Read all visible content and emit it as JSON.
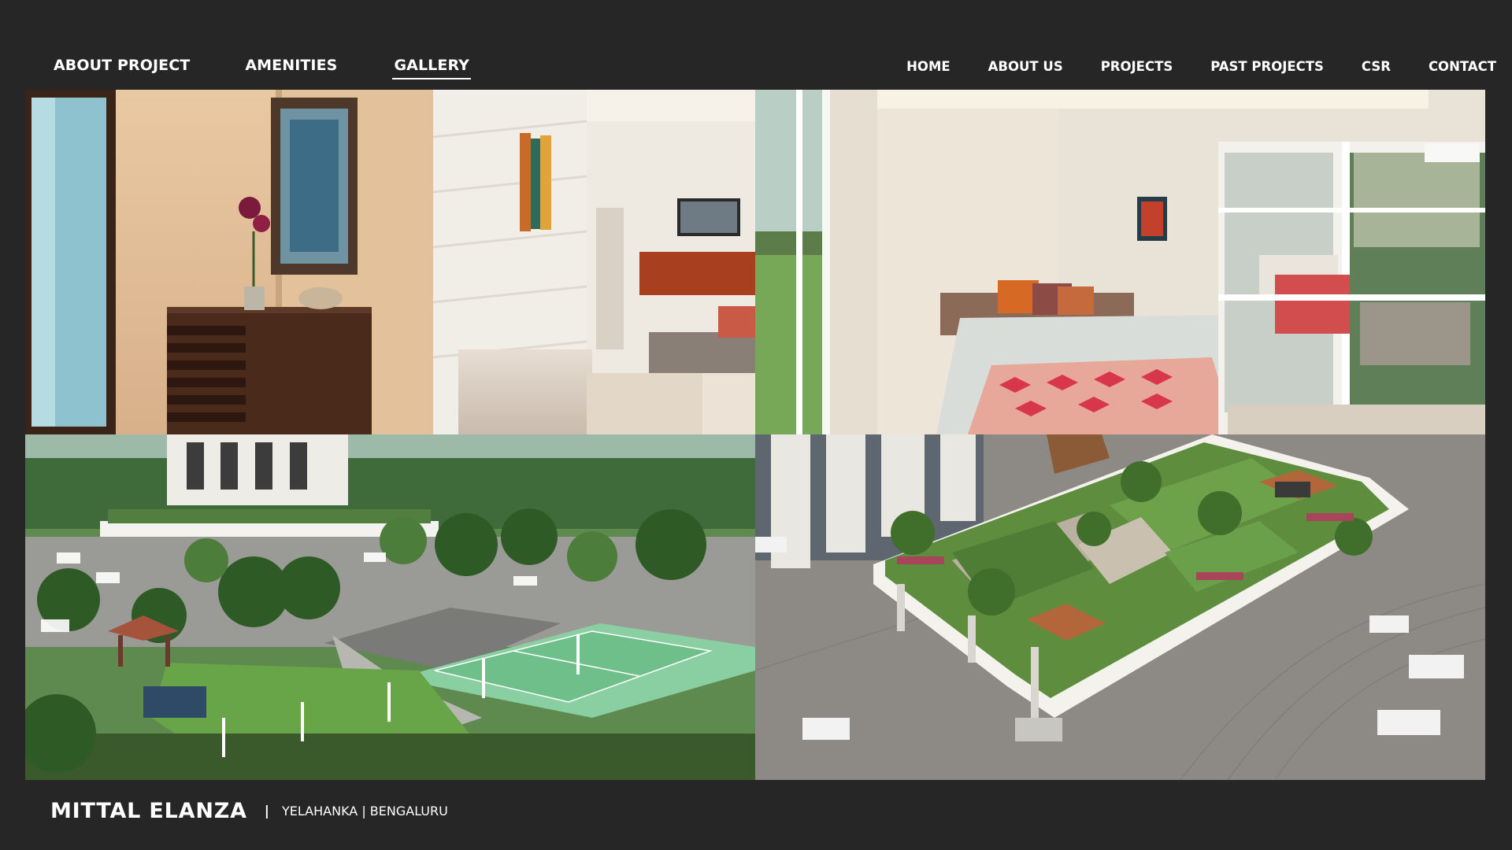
{
  "nav_left": {
    "about_project": "ABOUT PROJECT",
    "amenities": "AMENITIES",
    "gallery": "GALLERY"
  },
  "nav_right": {
    "home": "HOME",
    "about_us": "ABOUT US",
    "projects": "PROJECTS",
    "past_projects": "PAST PROJECTS",
    "csr": "CSR",
    "contact": "CONTACT"
  },
  "active_tab": "GALLERY",
  "gallery": [
    {
      "subject": "living-hallway-photo"
    },
    {
      "subject": "bedroom-photo"
    },
    {
      "subject": "sports-court-landscape-render"
    },
    {
      "subject": "rooftop-garden-render"
    }
  ],
  "footer": {
    "project_name": "MITTAL ELANZA",
    "separator": "|",
    "location": "YELAHANKA | BENGALURU"
  },
  "colors": {
    "background": "#262626",
    "text": "#ffffff"
  }
}
